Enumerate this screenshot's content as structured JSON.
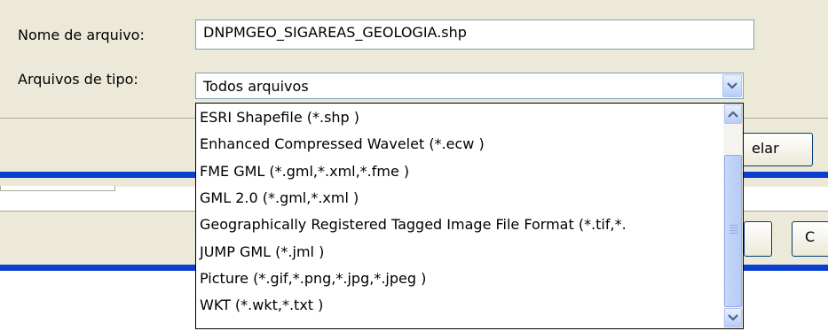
{
  "dialog": {
    "filename_label": "Nome de arquivo:",
    "filename_value": "DNPMGEO_SIGAREAS_GEOLOGIA.shp",
    "filetype_label": "Arquivos de tipo:",
    "filetype_value": "Todos arquivos",
    "cancel_button_partial": "elar",
    "second_button_partial": "C"
  },
  "dropdown": {
    "options": [
      "ESRI Shapefile (*.shp )",
      "Enhanced Compressed Wavelet (*.ecw )",
      "FME GML (*.gml,*.xml,*.fme )",
      "GML 2.0 (*.gml,*.xml )",
      "Geographically Registered Tagged Image File Format (*.tif,*.",
      "JUMP GML (*.jml )",
      "Picture (*.gif,*.png,*.jpg,*.jpeg )",
      "WKT (*.wkt,*.txt )"
    ]
  },
  "colors": {
    "dialog_bg": "#ece9d8",
    "field_border": "#7f9db9",
    "accent_blue_bar": "#0a3fcf",
    "scroll_button": "#b7cdf7"
  },
  "icons": {
    "combo_arrow": "chevron-down-icon",
    "scroll_up": "chevron-up-icon",
    "scroll_down": "chevron-down-icon",
    "thumb_grip": "grip-lines-icon"
  }
}
